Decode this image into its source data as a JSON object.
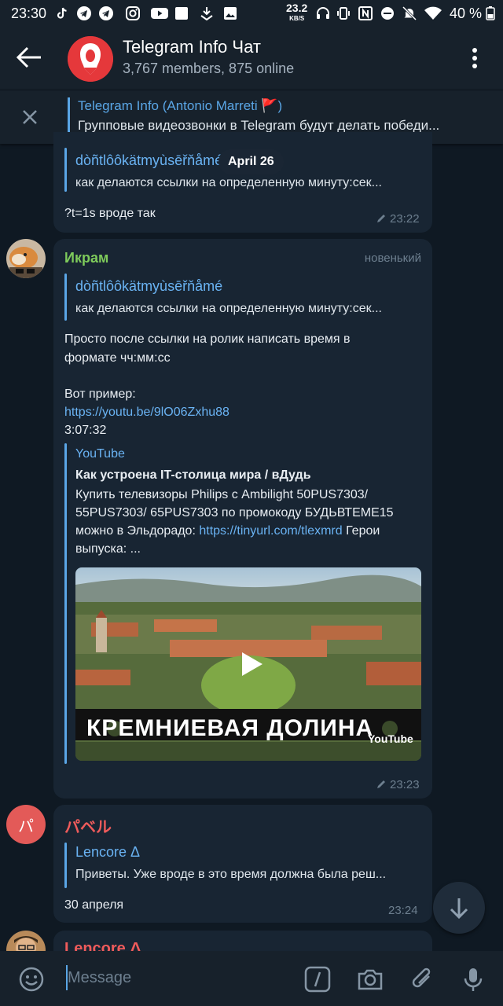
{
  "status_bar": {
    "time": "23:30",
    "net_speed": "23.2",
    "net_unit": "KB/S",
    "battery": "40 %"
  },
  "header": {
    "title": "Telegram Info Чат",
    "subtitle": "3,767 members, 875 online"
  },
  "pinned": {
    "title": "Telegram Info (Antonio Marreti 🚩)",
    "text": "Групповые видеозвонки в Telegram будут делать победи..."
  },
  "date_pill": "April 26",
  "messages": [
    {
      "reply_name": "dòñtlôôkätmyùsēřňåmé",
      "reply_text": "как делаются ссылки на определенную минуту:сек...",
      "text": "?t=1s вроде так",
      "time": "23:22"
    },
    {
      "author": "Икрам",
      "badge": "новенький",
      "reply_name": "dòñtlôôkätmyùsēřňåmé",
      "reply_text": "как делаются ссылки на определенную минуту:сек...",
      "text_line1": "Просто после ссылки на ролик написать время в",
      "text_line2": "формате чч:мм:сс",
      "text_line3": "Вот пример:",
      "link": "https://youtu.be/9lO06Zxhu88",
      "timestamp": "3:07:32",
      "preview": {
        "site": "YouTube",
        "title": "Как устроена IT-столица мира / вДудь",
        "desc1": "Купить телевизоры Philips с Ambilight 50PUS7303/",
        "desc2": "55PUS7303/ 65PUS7303 по промокоду БУДЬВТЕМЕ15",
        "desc3_prefix": "можно в Эльдорадо: ",
        "desc3_link": "https://tinyurl.com/tlexmrd",
        "desc3_suffix": " Герои",
        "desc4": "выпуска: ...",
        "thumb_caption": "КРЕМНИЕВАЯ ДОЛИНА",
        "thumb_logo": "YouTube"
      },
      "time": "23:23"
    },
    {
      "author": "パベル",
      "avatar_letter": "パ",
      "reply_name": "Lencore Δ",
      "reply_text": "Приветы. Уже вроде в это время должна была реш...",
      "text": "30 апреля",
      "time": "23:24"
    },
    {
      "author": "Lencore Δ"
    }
  ],
  "composer": {
    "placeholder": "Message"
  },
  "colors": {
    "accent": "#5aa6e6",
    "link": "#6ab3f3",
    "bubble": "#182533",
    "background": "#0f1923",
    "author_green": "#7ecb5b",
    "author_red": "#ef5b5b"
  }
}
